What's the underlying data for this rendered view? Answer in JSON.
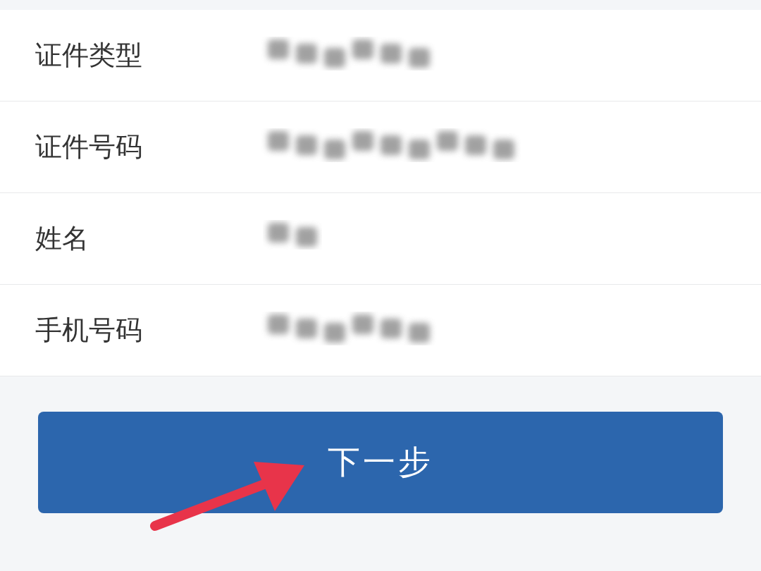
{
  "fields": [
    {
      "label": "证件类型"
    },
    {
      "label": "证件号码"
    },
    {
      "label": "姓名"
    },
    {
      "label": "手机号码"
    }
  ],
  "next_button": {
    "label": "下一步"
  }
}
